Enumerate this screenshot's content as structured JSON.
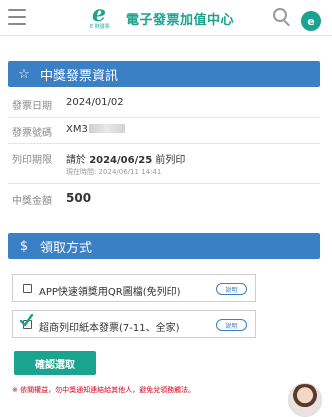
{
  "header": {
    "logo_mark": "e",
    "logo_sub": "E 財發票",
    "title": "電子發票加值中心",
    "avatar_letter": "e"
  },
  "invoice_section": {
    "title": "中獎發票資訊",
    "icon": "star-outline-icon",
    "rows": {
      "date": {
        "label": "發票日期",
        "value": "2024/01/02"
      },
      "number": {
        "label": "發票號碼",
        "value": "XM3"
      },
      "deadline": {
        "label": "列印期限",
        "prefix": "請於",
        "date": "2024/06/25",
        "suffix": "前列印",
        "current_time": "現在時間: 2024/06/11 14:41"
      },
      "amount": {
        "label": "中獎金額",
        "value": "500"
      }
    }
  },
  "claim_section": {
    "title": "領取方式",
    "icon": "dollar-icon",
    "options": [
      {
        "label": "APP快速領獎用QR圖檔(免列印)",
        "help": "說明",
        "checked": false
      },
      {
        "label": "超商列印紙本發票(7-11、全家)",
        "help": "說明",
        "checked": true
      }
    ],
    "confirm_label": "確認選取",
    "note": "※ 依關權益，勿中獎通知連結給其他人，避免兌領務觸法。"
  },
  "colors": {
    "brand": "#1aa38f",
    "section_header": "#3b7fc4",
    "alert": "#d0021b"
  }
}
